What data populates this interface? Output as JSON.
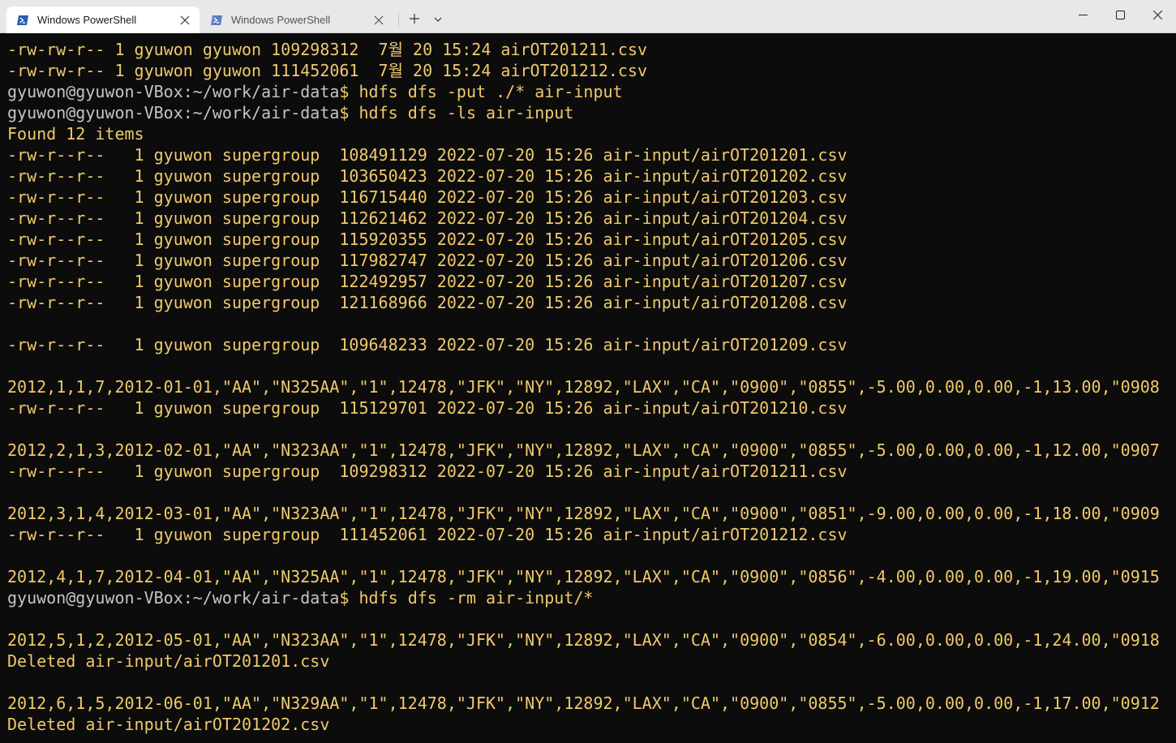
{
  "tabs": [
    {
      "label": "Windows PowerShell",
      "active": true
    },
    {
      "label": "Windows PowerShell",
      "active": false
    }
  ],
  "icons": {
    "tab_icon": "powershell-icon",
    "close": "close-icon",
    "new_tab": "plus-icon",
    "dropdown": "chevron-down-icon",
    "minimize": "minimize-icon",
    "maximize": "maximize-icon",
    "window_close": "window-close-icon"
  },
  "colors": {
    "terminal_bg": "#0c0c0c",
    "output_text": "#f0c96b",
    "prompt_text": "#c4c4c4",
    "titlebar_bg": "#e8e8e8",
    "powershell_blue": "#2a5cb0"
  },
  "terminal": {
    "lines": [
      {
        "text": "-rw-rw-r-- 1 gyuwon gyuwon 109298312  7월 20 15:24 airOT201211.csv"
      },
      {
        "text": "-rw-rw-r-- 1 gyuwon gyuwon 111452061  7월 20 15:24 airOT201212.csv"
      },
      {
        "host": "gyuwon@gyuwon-VBox",
        "path": ":~/work/air-data",
        "text": "$ hdfs dfs -put ./* air-input"
      },
      {
        "host": "gyuwon@gyuwon-VBox",
        "path": ":~/work/air-data",
        "text": "$ hdfs dfs -ls air-input"
      },
      {
        "text": "Found 12 items"
      },
      {
        "text": "-rw-r--r--   1 gyuwon supergroup  108491129 2022-07-20 15:26 air-input/airOT201201.csv"
      },
      {
        "text": "-rw-r--r--   1 gyuwon supergroup  103650423 2022-07-20 15:26 air-input/airOT201202.csv"
      },
      {
        "text": "-rw-r--r--   1 gyuwon supergroup  116715440 2022-07-20 15:26 air-input/airOT201203.csv"
      },
      {
        "text": "-rw-r--r--   1 gyuwon supergroup  112621462 2022-07-20 15:26 air-input/airOT201204.csv"
      },
      {
        "text": "-rw-r--r--   1 gyuwon supergroup  115920355 2022-07-20 15:26 air-input/airOT201205.csv"
      },
      {
        "text": "-rw-r--r--   1 gyuwon supergroup  117982747 2022-07-20 15:26 air-input/airOT201206.csv"
      },
      {
        "text": "-rw-r--r--   1 gyuwon supergroup  122492957 2022-07-20 15:26 air-input/airOT201207.csv"
      },
      {
        "text": "-rw-r--r--   1 gyuwon supergroup  121168966 2022-07-20 15:26 air-input/airOT201208.csv"
      },
      {
        "text": ""
      },
      {
        "text": "-rw-r--r--   1 gyuwon supergroup  109648233 2022-07-20 15:26 air-input/airOT201209.csv"
      },
      {
        "text": ""
      },
      {
        "text": "2012,1,1,7,2012-01-01,\"AA\",\"N325AA\",\"1\",12478,\"JFK\",\"NY\",12892,\"LAX\",\"CA\",\"0900\",\"0855\",-5.00,0.00,0.00,-1,13.00,\"0908"
      },
      {
        "text": "-rw-r--r--   1 gyuwon supergroup  115129701 2022-07-20 15:26 air-input/airOT201210.csv"
      },
      {
        "text": ""
      },
      {
        "text": "2012,2,1,3,2012-02-01,\"AA\",\"N323AA\",\"1\",12478,\"JFK\",\"NY\",12892,\"LAX\",\"CA\",\"0900\",\"0855\",-5.00,0.00,0.00,-1,12.00,\"0907"
      },
      {
        "text": "-rw-r--r--   1 gyuwon supergroup  109298312 2022-07-20 15:26 air-input/airOT201211.csv"
      },
      {
        "text": ""
      },
      {
        "text": "2012,3,1,4,2012-03-01,\"AA\",\"N323AA\",\"1\",12478,\"JFK\",\"NY\",12892,\"LAX\",\"CA\",\"0900\",\"0851\",-9.00,0.00,0.00,-1,18.00,\"0909"
      },
      {
        "text": "-rw-r--r--   1 gyuwon supergroup  111452061 2022-07-20 15:26 air-input/airOT201212.csv"
      },
      {
        "text": ""
      },
      {
        "text": "2012,4,1,7,2012-04-01,\"AA\",\"N325AA\",\"1\",12478,\"JFK\",\"NY\",12892,\"LAX\",\"CA\",\"0900\",\"0856\",-4.00,0.00,0.00,-1,19.00,\"0915"
      },
      {
        "host": "gyuwon@gyuwon-VBox",
        "path": ":~/work/air-data",
        "text": "$ hdfs dfs -rm air-input/*"
      },
      {
        "text": ""
      },
      {
        "text": "2012,5,1,2,2012-05-01,\"AA\",\"N323AA\",\"1\",12478,\"JFK\",\"NY\",12892,\"LAX\",\"CA\",\"0900\",\"0854\",-6.00,0.00,0.00,-1,24.00,\"0918"
      },
      {
        "text": "Deleted air-input/airOT201201.csv"
      },
      {
        "text": ""
      },
      {
        "text": "2012,6,1,5,2012-06-01,\"AA\",\"N329AA\",\"1\",12478,\"JFK\",\"NY\",12892,\"LAX\",\"CA\",\"0900\",\"0855\",-5.00,0.00,0.00,-1,17.00,\"0912"
      },
      {
        "text": "Deleted air-input/airOT201202.csv"
      }
    ]
  }
}
